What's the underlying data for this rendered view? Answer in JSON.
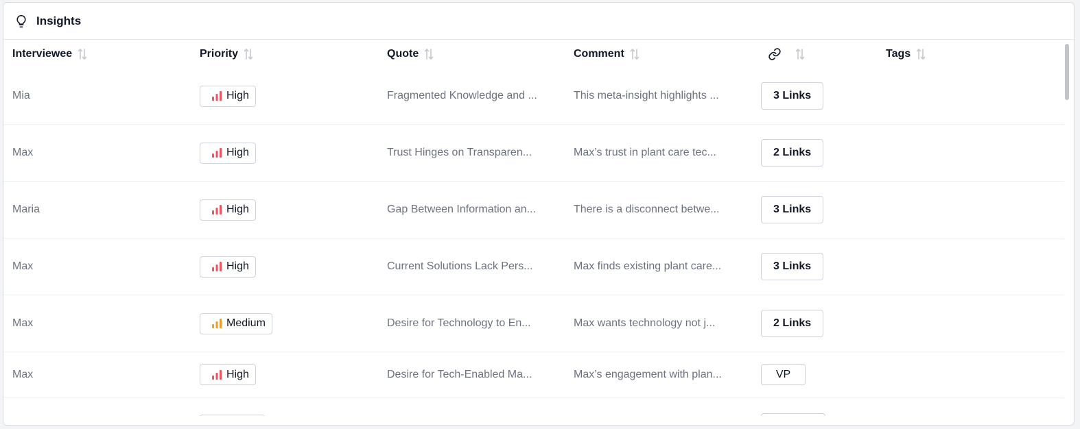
{
  "panel": {
    "title": "Insights",
    "icon": "lightbulb-icon"
  },
  "columns": {
    "interviewee": "Interviewee",
    "priority": "Priority",
    "quote": "Quote",
    "comment": "Comment",
    "links_icon": "link-icon",
    "tags": "Tags"
  },
  "colors": {
    "high": "#f0505f",
    "medium": "#f39a2b",
    "bar_off": "#f5c7cc"
  },
  "rows": [
    {
      "interviewee": "Mia",
      "priority": "High",
      "priority_level": "high",
      "quote": "Fragmented Knowledge and ...",
      "comment": "This meta-insight highlights ...",
      "links": "3 Links",
      "links_kind": "links",
      "tags": ""
    },
    {
      "interviewee": "Max",
      "priority": "High",
      "priority_level": "high",
      "quote": "Trust Hinges on Transparen...",
      "comment": "Max’s trust in plant care tec...",
      "links": "2 Links",
      "links_kind": "links",
      "tags": ""
    },
    {
      "interviewee": "Maria",
      "priority": "High",
      "priority_level": "high",
      "quote": "Gap Between Information an...",
      "comment": "There is a disconnect betwe...",
      "links": "3 Links",
      "links_kind": "links",
      "tags": ""
    },
    {
      "interviewee": "Max",
      "priority": "High",
      "priority_level": "high",
      "quote": "Current Solutions Lack Pers...",
      "comment": "Max finds existing plant care...",
      "links": "3 Links",
      "links_kind": "links",
      "tags": ""
    },
    {
      "interviewee": "Max",
      "priority": "Medium",
      "priority_level": "medium",
      "quote": "Desire for Technology to En...",
      "comment": "Max wants technology not j...",
      "links": "2 Links",
      "links_kind": "links",
      "tags": ""
    },
    {
      "interviewee": "Max",
      "priority": "High",
      "priority_level": "high",
      "quote": "Desire for Tech-Enabled Ma...",
      "comment": "Max’s engagement with plan...",
      "links": "VP",
      "links_kind": "tag",
      "tags": ""
    }
  ]
}
